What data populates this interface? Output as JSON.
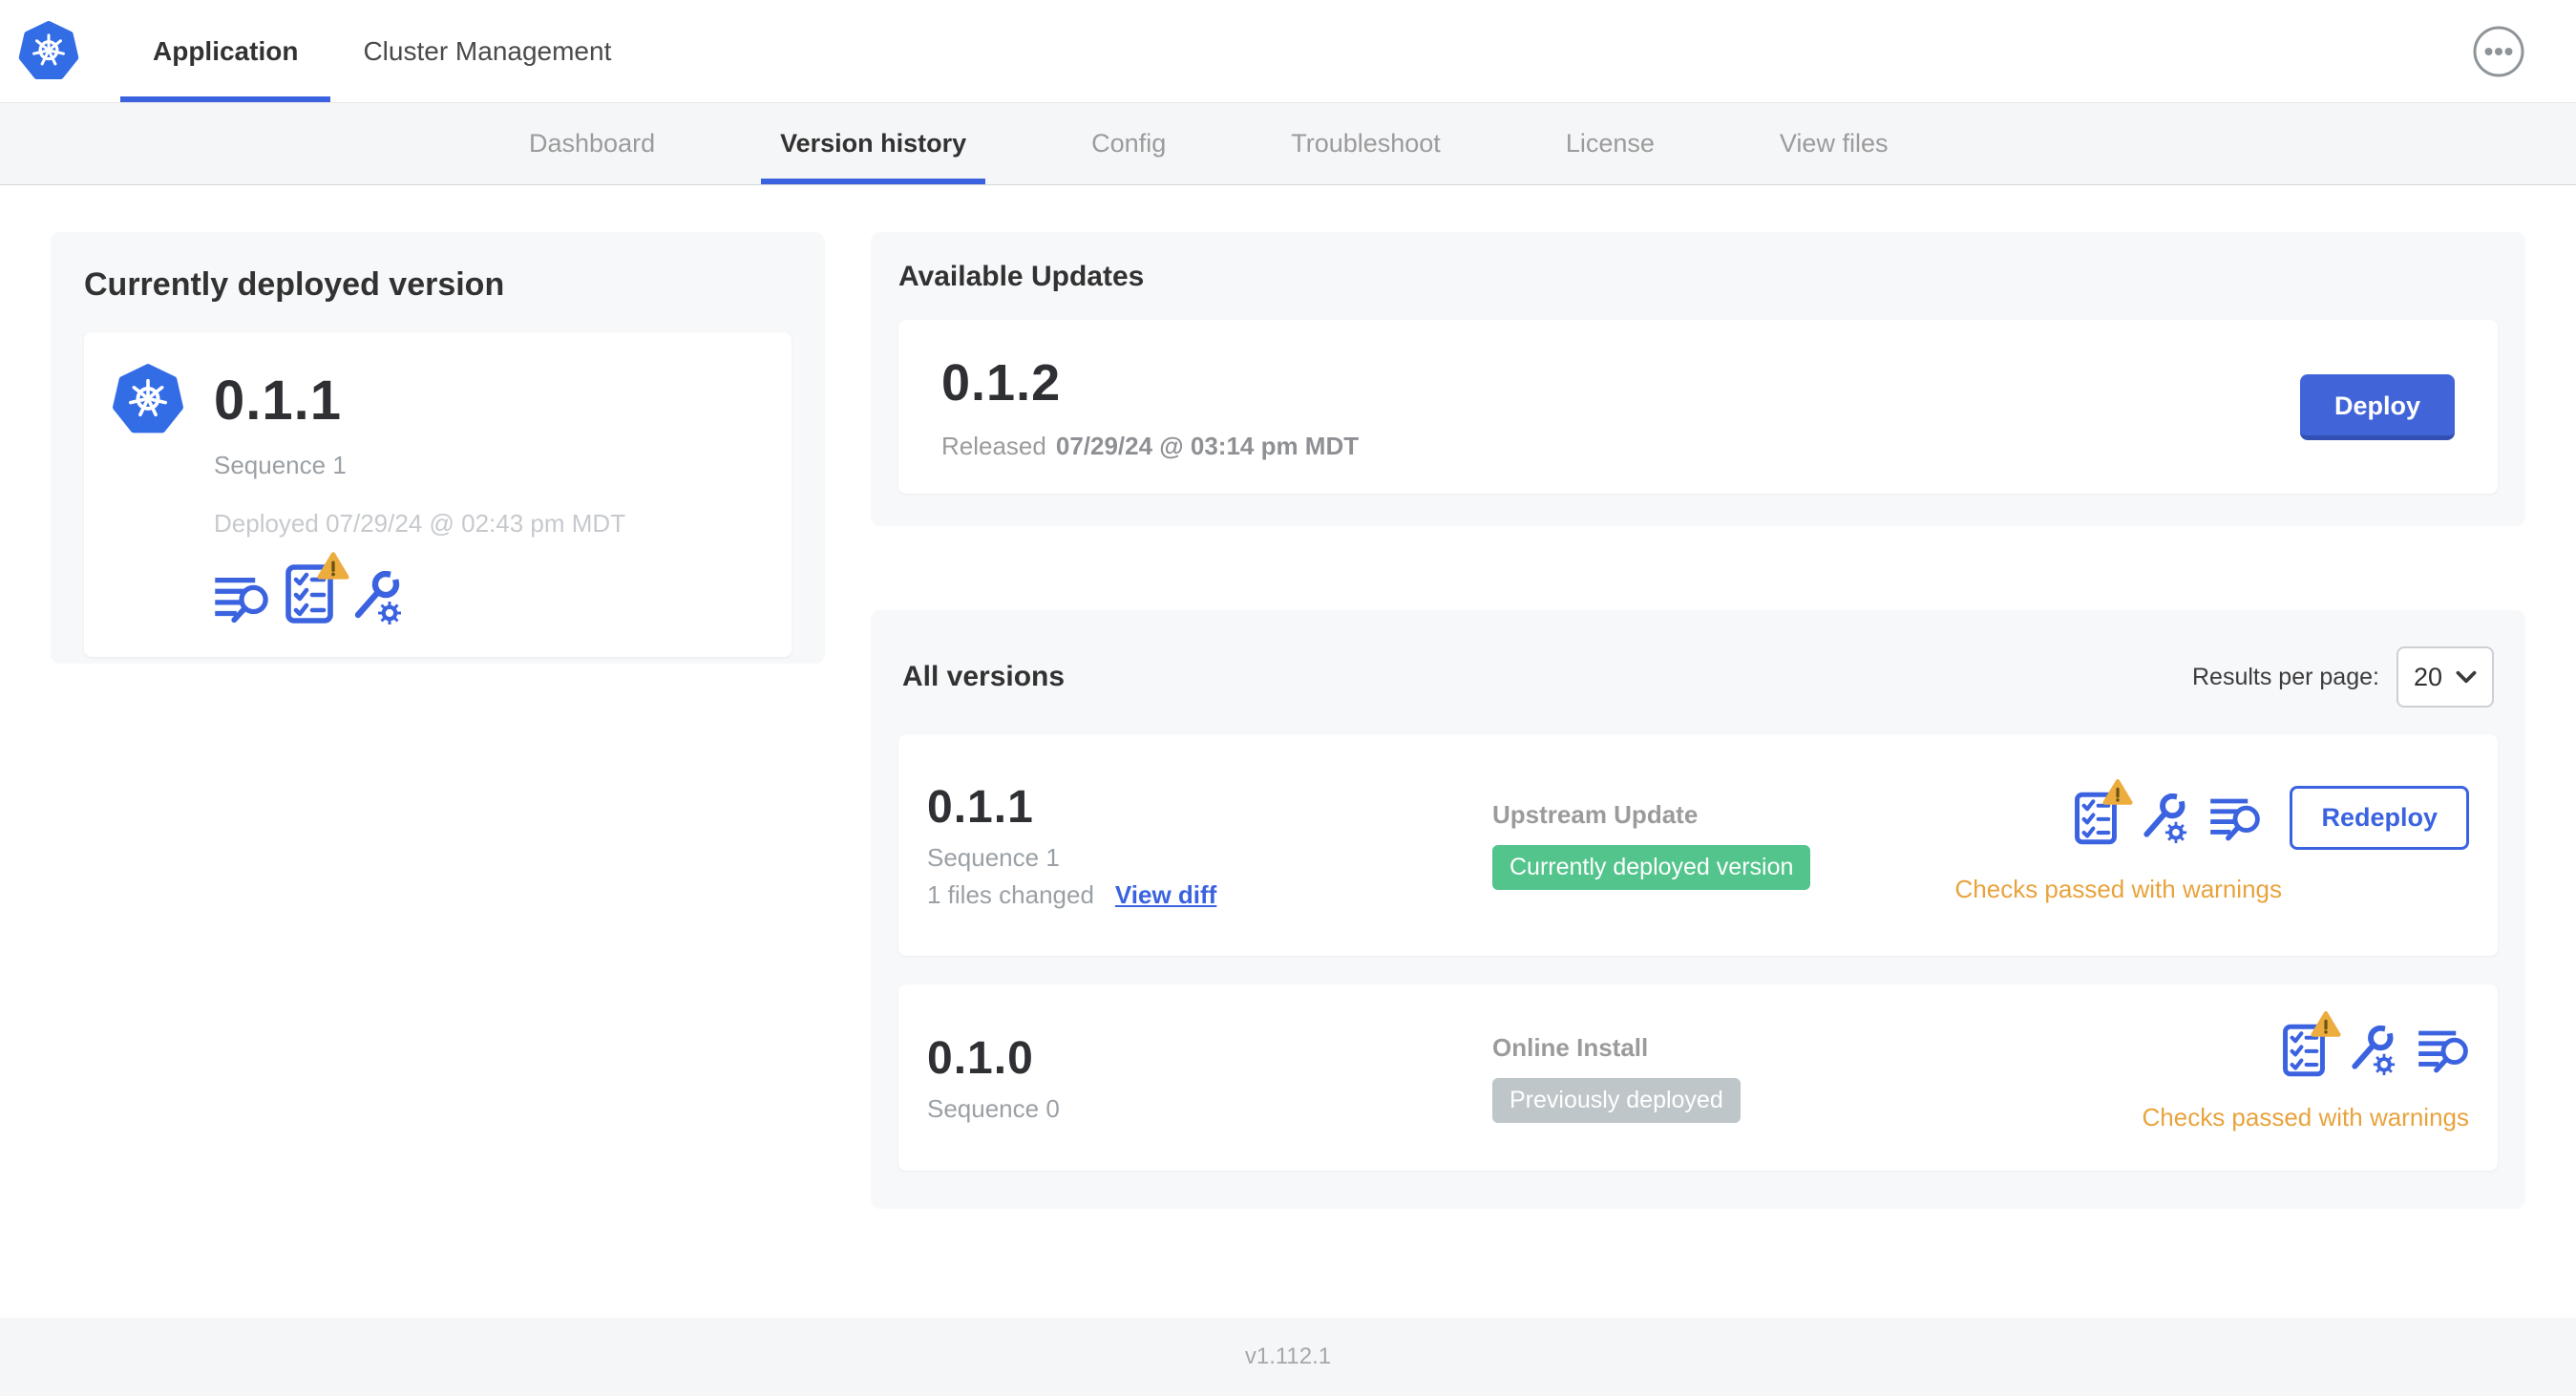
{
  "colors": {
    "accent_blue": "#3b63e0",
    "kubernetes_blue": "#326de6",
    "deploy_button_blue": "#4164d9",
    "success_green": "#52c48c",
    "neutral_badge_gray": "#bfc6c9",
    "warning_amber": "#e8a33d"
  },
  "header": {
    "tabs": [
      {
        "label": "Application"
      },
      {
        "label": "Cluster Management"
      }
    ]
  },
  "subnav": {
    "tabs": [
      {
        "label": "Dashboard"
      },
      {
        "label": "Version history"
      },
      {
        "label": "Config"
      },
      {
        "label": "Troubleshoot"
      },
      {
        "label": "License"
      },
      {
        "label": "View files"
      }
    ]
  },
  "current_version": {
    "title": "Currently deployed version",
    "version": "0.1.1",
    "sequence": "Sequence 1",
    "deployed": "Deployed 07/29/24 @ 02:43 pm MDT"
  },
  "available_updates": {
    "title": "Available Updates",
    "version": "0.1.2",
    "released_prefix": "Released",
    "released_date": "07/29/24 @ 03:14 pm MDT",
    "deploy_label": "Deploy"
  },
  "all_versions": {
    "title": "All versions",
    "results_per_page_label": "Results per page:",
    "results_per_page_value": "20",
    "rows": [
      {
        "version": "0.1.1",
        "sequence": "Sequence 1",
        "files_changed": "1 files changed",
        "view_diff_label": "View diff",
        "source": "Upstream Update",
        "badge": "Currently deployed version",
        "status": "Checks passed with warnings",
        "action_label": "Redeploy"
      },
      {
        "version": "0.1.0",
        "sequence": "Sequence 0",
        "source": "Online Install",
        "badge": "Previously deployed",
        "status": "Checks passed with warnings"
      }
    ]
  },
  "footer": {
    "version_label": "v1.112.1"
  }
}
